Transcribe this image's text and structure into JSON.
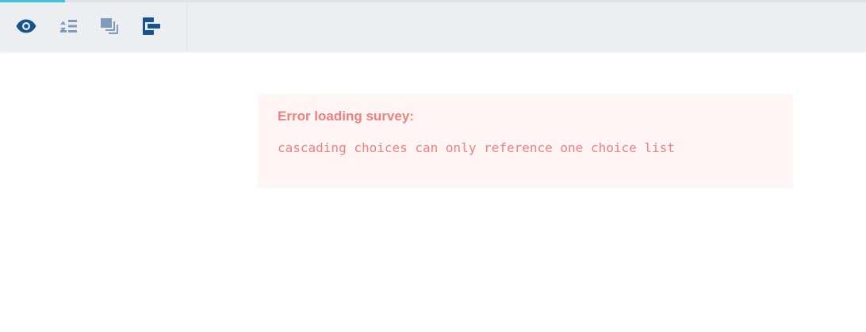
{
  "toolbar": {
    "buttons": [
      {
        "icon": "eye-icon",
        "color": "#16548f"
      },
      {
        "icon": "sort-list-icon",
        "color": "#7d9cc0"
      },
      {
        "icon": "layers-icon",
        "color": "#7d9cc0"
      },
      {
        "icon": "flow-icon",
        "color": "#16548f"
      }
    ]
  },
  "error": {
    "title": "Error loading survey:",
    "message": "cascading choices can only reference one choice list"
  },
  "colors": {
    "accent": "#3fc1e0",
    "error_text": "#f0807c",
    "error_bg": "#fff5f4",
    "toolbar_bg": "#eceef1"
  }
}
